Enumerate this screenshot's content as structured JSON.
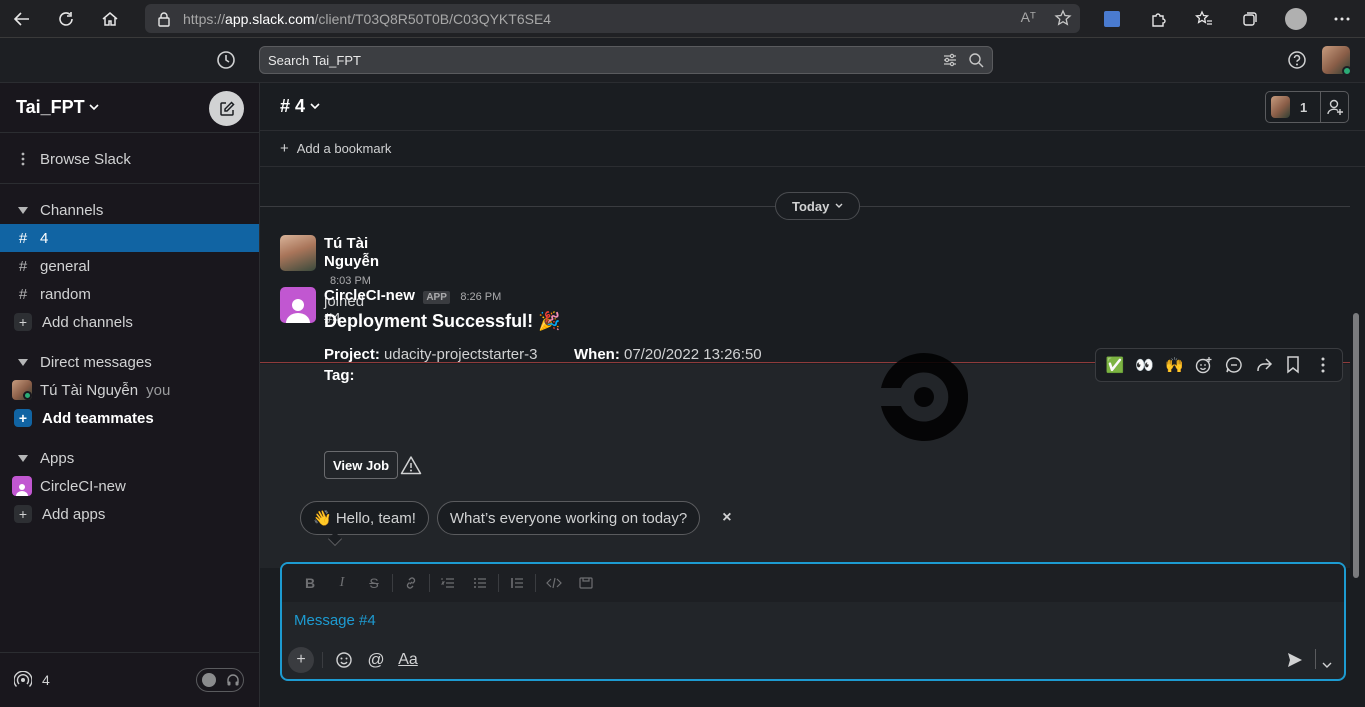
{
  "browser": {
    "url_prefix": "https://",
    "url_domain": "app.slack.com",
    "url_path": "/client/T03Q8R50T0B/C03QYKT6SE4",
    "reader_label": "Aᵀ"
  },
  "topbar": {
    "search_placeholder": "Search Tai_FPT"
  },
  "sidebar": {
    "workspace": "Tai_FPT",
    "browse": "Browse Slack",
    "channels_header": "Channels",
    "channels": [
      {
        "name": "4",
        "active": true
      },
      {
        "name": "general",
        "active": false
      },
      {
        "name": "random",
        "active": false
      }
    ],
    "add_channels": "Add channels",
    "dm_header": "Direct messages",
    "dm_user": "Tú Tài Nguyễn",
    "dm_you": "you",
    "add_teammates": "Add teammates",
    "apps_header": "Apps",
    "app_name": "CircleCI-new",
    "add_apps": "Add apps",
    "huddle_count": "4"
  },
  "channel": {
    "name": "# 4",
    "member_count": "1",
    "add_bookmark": "Add a bookmark",
    "day_divider": "Today"
  },
  "messages": [
    {
      "author": "Tú Tài Nguyễn",
      "time": "8:03 PM",
      "text": "joined #4."
    },
    {
      "author": "CircleCI-new",
      "badge": "APP",
      "time": "8:26 PM",
      "title": "Deployment Successful! 🎉",
      "project_label": "Project:",
      "project_value": "udacity-projectstarter-3",
      "when_label": "When:",
      "when_value": "07/20/2022 13:26:50",
      "tag_label": "Tag:",
      "button": "View Job"
    }
  ],
  "message_actions": {
    "check": "✅",
    "eyes": "👀",
    "raised_hands": "🙌"
  },
  "suggestions": {
    "hello": "👋  Hello, team!",
    "working": "What’s everyone working on today?",
    "close": "×"
  },
  "composer": {
    "placeholder": "Message #4",
    "fmt_bold": "B",
    "fmt_italic": "I",
    "fmt_strike": "S",
    "text_format": "Aa",
    "at": "@"
  },
  "colors": {
    "sidebar_bg": "#19171d",
    "active_channel": "#1164a3",
    "composer_border": "#1d9bd1",
    "app_avatar": "#c157d1",
    "presence": "#2bac76"
  }
}
